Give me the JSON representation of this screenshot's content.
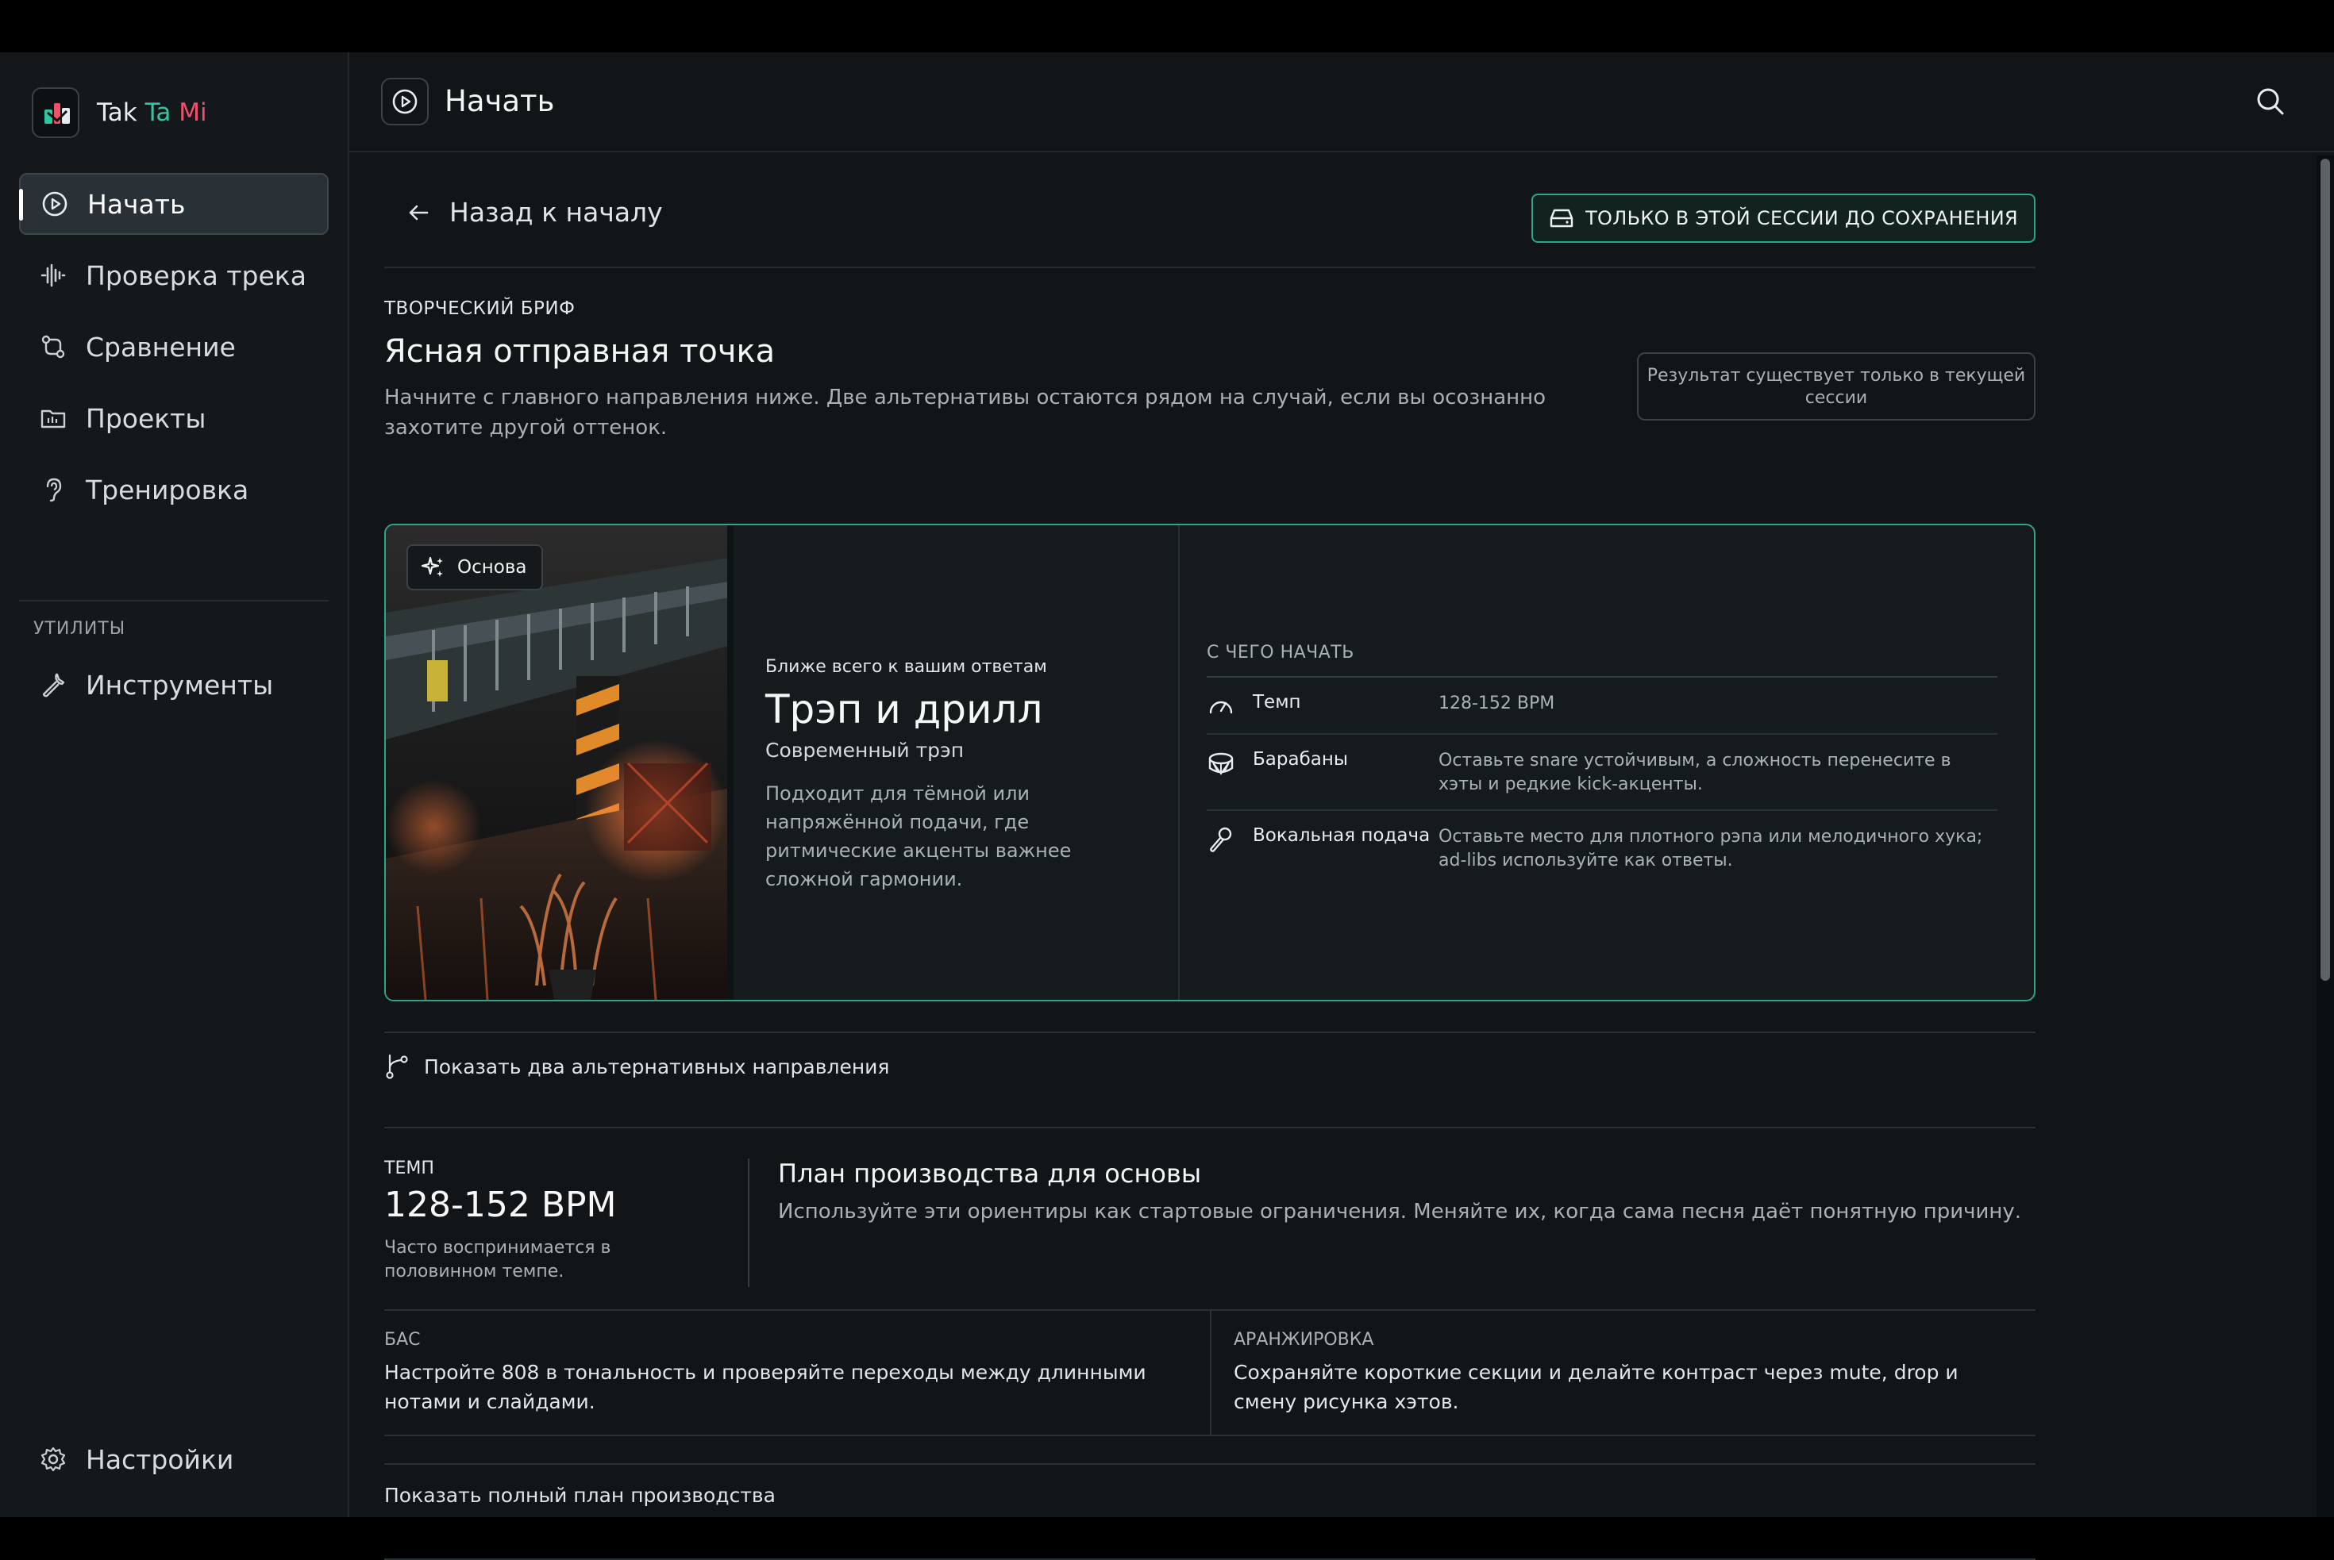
{
  "app": {
    "brand": {
      "part1": "Tak",
      "part2": "Ta",
      "part3": "Mi"
    }
  },
  "sidebar": {
    "items": [
      {
        "label": "Начать",
        "icon": "play-circle-icon",
        "active": true
      },
      {
        "label": "Проверка трека",
        "icon": "waveform-icon",
        "active": false
      },
      {
        "label": "Сравнение",
        "icon": "compare-icon",
        "active": false
      },
      {
        "label": "Проекты",
        "icon": "folder-icon",
        "active": false
      },
      {
        "label": "Тренировка",
        "icon": "ear-icon",
        "active": false
      }
    ],
    "utilities_heading": "УТИЛИТЫ",
    "utilities": [
      {
        "label": "Инструменты",
        "icon": "wrench-icon"
      }
    ],
    "settings_label": "Настройки"
  },
  "header": {
    "title": "Начать"
  },
  "back": {
    "label": "Назад к началу"
  },
  "session_pill": {
    "label": "ТОЛЬКО В ЭТОЙ СЕССИИ ДО СОХРАНЕНИЯ"
  },
  "brief": {
    "eyebrow": "ТВОРЧЕСКИЙ БРИФ",
    "title": "Ясная отправная точка",
    "description": "Начните с главного направления ниже. Две альтернативы остаются рядом на случай, если вы осознанно захотите другой оттенок.",
    "session_note": "Результат существует только в текущей сессии"
  },
  "primary_card": {
    "badge": "Основа",
    "eyebrow": "Ближе всего к вашим ответам",
    "title": "Трэп и дрилл",
    "subtitle": "Современный трэп",
    "description": "Подходит для тёмной или напряжённой подачи, где ритмические акценты важнее сложной гармонии.",
    "start_heading": "С ЧЕГО НАЧАТЬ",
    "start_rows": [
      {
        "icon": "gauge-icon",
        "label": "Темп",
        "value": "128-152 BPM"
      },
      {
        "icon": "drum-icon",
        "label": "Барабаны",
        "value": "Оставьте snare устойчивым, а сложность перенесите в хэты и редкие kick-акценты."
      },
      {
        "icon": "microphone-icon",
        "label": "Вокальная подача",
        "value": "Оставьте место для плотного рэпа или мелодичного хука; ad-libs используйте как ответы."
      }
    ]
  },
  "alternatives": {
    "label": "Показать два альтернативных направления"
  },
  "tempo": {
    "eyebrow": "ТЕМП",
    "value": "128-152 BPM",
    "note": "Часто воспринимается в половинном темпе."
  },
  "plan": {
    "title": "План производства для основы",
    "description": "Используйте эти ориентиры как стартовые ограничения. Меняйте их, когда сама песня даёт понятную причину."
  },
  "bass": {
    "eyebrow": "БАС",
    "text": "Настройте 808 в тональность и проверяйте переходы между длинными нотами и слайдами."
  },
  "arrangement": {
    "eyebrow": "АРАНЖИРОВКА",
    "text": "Сохраняйте короткие секции и делайте контраст через mute, drop и смену рисунка хэтов."
  },
  "full_plan": {
    "label": "Показать полный план производства"
  },
  "colors": {
    "accent": "#2ca58a",
    "brand_teal": "#2fc6a3",
    "brand_pink": "#f0506a",
    "background": "#111518",
    "sidebar": "#14181b"
  }
}
